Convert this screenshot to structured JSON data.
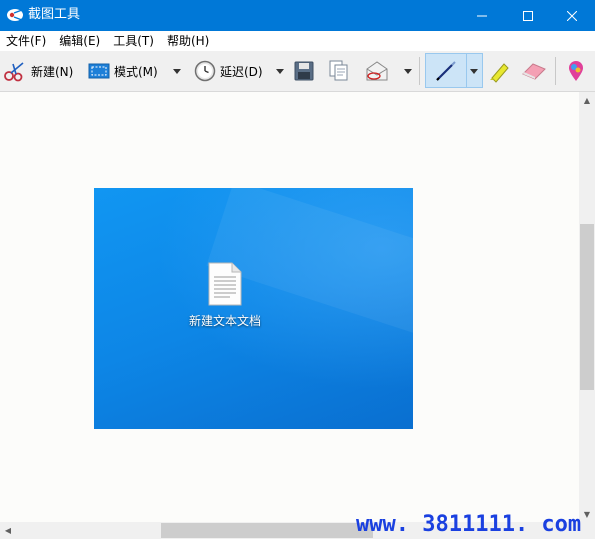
{
  "window": {
    "title": "截图工具"
  },
  "menu": {
    "items": [
      "文件(F)",
      "编辑(E)",
      "工具(T)",
      "帮助(H)"
    ]
  },
  "toolbar": {
    "new_label": "新建(N)",
    "mode_label": "模式(M)",
    "delay_label": "延迟(D)"
  },
  "canvas": {
    "file_label": "新建文本文档"
  },
  "watermark": {
    "text": "www. 3811111. com"
  },
  "colors": {
    "titlebar": "#0078d7",
    "accent_watermark": "#1a40e0"
  }
}
